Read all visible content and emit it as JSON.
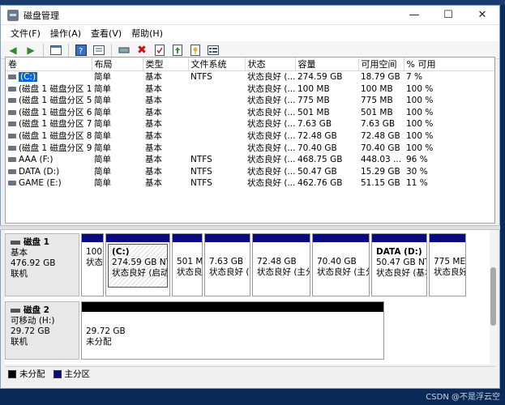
{
  "window": {
    "title": "磁盘管理"
  },
  "controls": {
    "minimize": "—",
    "maximize": "☐",
    "close": "✕"
  },
  "menu": [
    "文件(F)",
    "操作(A)",
    "查看(V)",
    "帮助(H)"
  ],
  "columns": [
    "卷",
    "布局",
    "类型",
    "文件系统",
    "状态",
    "容量",
    "可用空间",
    "% 可用"
  ],
  "volumes": [
    [
      "(C:)",
      "简单",
      "基本",
      "NTFS",
      "状态良好 (...",
      "274.59 GB",
      "18.79 GB",
      "7 %"
    ],
    [
      "(磁盘 1 磁盘分区 1)",
      "简单",
      "基本",
      "",
      "状态良好 (...",
      "100 MB",
      "100 MB",
      "100 %"
    ],
    [
      "(磁盘 1 磁盘分区 5)",
      "简单",
      "基本",
      "",
      "状态良好 (...",
      "775 MB",
      "775 MB",
      "100 %"
    ],
    [
      "(磁盘 1 磁盘分区 6)",
      "简单",
      "基本",
      "",
      "状态良好 (...",
      "501 MB",
      "501 MB",
      "100 %"
    ],
    [
      "(磁盘 1 磁盘分区 7)",
      "简单",
      "基本",
      "",
      "状态良好 (...",
      "7.63 GB",
      "7.63 GB",
      "100 %"
    ],
    [
      "(磁盘 1 磁盘分区 8)",
      "简单",
      "基本",
      "",
      "状态良好 (...",
      "72.48 GB",
      "72.48 GB",
      "100 %"
    ],
    [
      "(磁盘 1 磁盘分区 9)",
      "简单",
      "基本",
      "",
      "状态良好 (...",
      "70.40 GB",
      "70.40 GB",
      "100 %"
    ],
    [
      "AAA (F:)",
      "简单",
      "基本",
      "NTFS",
      "状态良好 (...",
      "468.75 GB",
      "448.03 ...",
      "96 %"
    ],
    [
      "DATA (D:)",
      "简单",
      "基本",
      "NTFS",
      "状态良好 (...",
      "50.47 GB",
      "15.29 GB",
      "30 %"
    ],
    [
      "GAME (E:)",
      "简单",
      "基本",
      "NTFS",
      "状态良好 (...",
      "462.76 GB",
      "51.15 GB",
      "11 %"
    ]
  ],
  "disk1": {
    "name": "磁盘 1",
    "type": "基本",
    "size": "476.92 GB",
    "status": "联机",
    "partitions": [
      {
        "name": "",
        "line1": "100",
        "line2": "状态"
      },
      {
        "name": "(C:)",
        "line1": "274.59 GB NTF",
        "line2": "状态良好 (启动,",
        "hatched": true
      },
      {
        "name": "",
        "line1": "501 M",
        "line2": "状态良"
      },
      {
        "name": "",
        "line1": "7.63 GB",
        "line2": "状态良好 ("
      },
      {
        "name": "",
        "line1": "72.48 GB",
        "line2": "状态良好 (主分"
      },
      {
        "name": "",
        "line1": "70.40 GB",
        "line2": "状态良好 (主分"
      },
      {
        "name": "DATA  (D:)",
        "line1": "50.47 GB NT",
        "line2": "状态良好 (基本"
      },
      {
        "name": "",
        "line1": "775 ME",
        "line2": "状态良好"
      }
    ]
  },
  "disk2": {
    "name": "磁盘 2",
    "type": "可移动 (H:)",
    "size": "29.72 GB",
    "status": "联机",
    "partitions": [
      {
        "name": "",
        "line1": "29.72 GB",
        "line2": "未分配"
      }
    ]
  },
  "legend": [
    "未分配",
    "主分区"
  ],
  "colors": {
    "unallocated": "#000000",
    "primary": "#0a0a80"
  },
  "watermark": "CSDN @不是浮云空"
}
